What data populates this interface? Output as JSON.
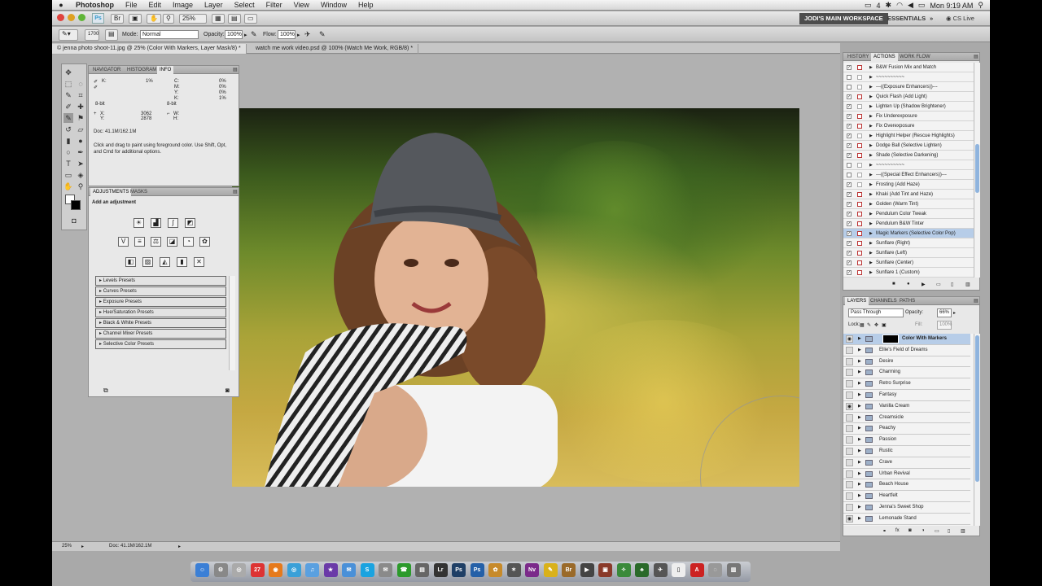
{
  "menubar": {
    "app_name": "Photoshop",
    "items": [
      "File",
      "Edit",
      "Image",
      "Layer",
      "Select",
      "Filter",
      "View",
      "Window",
      "Help"
    ],
    "status": {
      "battery": "4",
      "clock": "Mon 9:19 AM"
    }
  },
  "appbar": {
    "zoom": "25%",
    "workspace_primary": "JODI'S MAIN WORKSPACE",
    "workspace_secondary": "ESSENTIALS",
    "more": "»",
    "cs_live": "CS Live"
  },
  "options": {
    "brush_size": "1700",
    "mode_label": "Mode:",
    "mode_value": "Normal",
    "opacity_label": "Opacity:",
    "opacity_value": "100%",
    "flow_label": "Flow:",
    "flow_value": "100%"
  },
  "tabs": [
    {
      "label": "© jenna photo shoot-11.jpg @ 25% (Color With Markers, Layer Mask/8) *",
      "active": true
    },
    {
      "label": "watch me work video.psd @ 100% (Watch Me Work, RGB/8) *",
      "active": false
    }
  ],
  "info_panel": {
    "tabs": [
      "NAVIGATOR",
      "HISTOGRAM",
      "INFO"
    ],
    "r_label": "K:",
    "r_value": "1%",
    "c_label": "C:",
    "c_value": "0%",
    "m_label": "M:",
    "m_value": "0%",
    "y_label": "Y:",
    "y_value": "0%",
    "k_label": "K:",
    "k_value": "1%",
    "bit_left": "8-bit",
    "bit_right": "8-bit",
    "x_label": "X:",
    "x_value": "3062",
    "y_coord_label": "Y:",
    "y_coord_value": "2878",
    "w_label": "W:",
    "h_label": "H:",
    "doc": "Doc: 41.1M/162.1M",
    "hint": "Click and drag to paint using foreground color.  Use Shift, Opt, and Cmd for additional options."
  },
  "adjustments_panel": {
    "tabs": [
      "ADJUSTMENTS",
      "MASKS"
    ],
    "heading": "Add an adjustment",
    "presets": [
      "Levels Presets",
      "Curves Presets",
      "Exposure Presets",
      "Hue/Saturation Presets",
      "Black & White Presets",
      "Channel Mixer Presets",
      "Selective Color Presets"
    ]
  },
  "actions_panel": {
    "tabs": [
      "HISTORY",
      "ACTIONS",
      "WORK FLOW"
    ],
    "rows": [
      {
        "label": "B&W Fusion Mix and Match",
        "checked": true,
        "dialog": true
      },
      {
        "label": "~~~~~~~~~~",
        "checked": false,
        "dialog": false
      },
      {
        "label": "---((Exposure Enhancers))---",
        "checked": false,
        "dialog": false
      },
      {
        "label": "Quick Flash (Add Light)",
        "checked": true,
        "dialog": true
      },
      {
        "label": "Lighten Up (Shadow Brightener)",
        "checked": true,
        "dialog": false
      },
      {
        "label": "Fix Underexposure",
        "checked": true,
        "dialog": true
      },
      {
        "label": "Fix Overexposure",
        "checked": true,
        "dialog": true
      },
      {
        "label": "Highlight Helper (Rescue Highlights)",
        "checked": true,
        "dialog": false
      },
      {
        "label": "Dodge Ball (Selective Lighten)",
        "checked": true,
        "dialog": true
      },
      {
        "label": "Shade (Selective Darkening)",
        "checked": true,
        "dialog": true
      },
      {
        "label": "~~~~~~~~~~",
        "checked": false,
        "dialog": false
      },
      {
        "label": "---((Special Effect Enhancers))---",
        "checked": false,
        "dialog": false
      },
      {
        "label": "Frosting (Add Haze)",
        "checked": true,
        "dialog": false
      },
      {
        "label": "Khaki (Add Tint and Haze)",
        "checked": true,
        "dialog": true
      },
      {
        "label": "Golden (Warm Tint)",
        "checked": true,
        "dialog": true
      },
      {
        "label": "Pendulum Color Tweak",
        "checked": true,
        "dialog": true
      },
      {
        "label": "Pendulum B&W Tinter",
        "checked": true,
        "dialog": true
      },
      {
        "label": "Magic Markers (Selective Color Pop)",
        "checked": true,
        "dialog": true,
        "selected": true
      },
      {
        "label": "Sunflare (Right)",
        "checked": true,
        "dialog": true
      },
      {
        "label": "Sunflare (Left)",
        "checked": true,
        "dialog": true
      },
      {
        "label": "Sunflare (Center)",
        "checked": true,
        "dialog": true
      },
      {
        "label": "Sunflare 1 (Custom)",
        "checked": true,
        "dialog": true
      }
    ]
  },
  "layers_panel": {
    "tabs": [
      "LAYERS",
      "CHANNELS",
      "PATHS"
    ],
    "blend_mode": "Pass Through",
    "opacity_label": "Opacity:",
    "opacity_value": "66%",
    "lock_label": "Lock:",
    "fill_label": "Fill:",
    "fill_value": "100%",
    "layers": [
      {
        "name": "Color With Markers",
        "visible": true,
        "selected": true
      },
      {
        "name": "Ellie's Field of Dreams",
        "visible": false
      },
      {
        "name": "Desire",
        "visible": false
      },
      {
        "name": "Charming",
        "visible": false
      },
      {
        "name": "Retro Surprise",
        "visible": false
      },
      {
        "name": "Fantasy",
        "visible": false
      },
      {
        "name": "Vanilla Cream",
        "visible": true
      },
      {
        "name": "Creamsicle",
        "visible": false
      },
      {
        "name": "Peachy",
        "visible": false
      },
      {
        "name": "Passion",
        "visible": false
      },
      {
        "name": "Rustic",
        "visible": false
      },
      {
        "name": "Crave",
        "visible": false
      },
      {
        "name": "Urban Revival",
        "visible": false
      },
      {
        "name": "Beach House",
        "visible": false
      },
      {
        "name": "Heartfelt",
        "visible": false
      },
      {
        "name": "Jenna's Sweet Shop",
        "visible": false
      },
      {
        "name": "Lemonade Stand",
        "visible": true
      }
    ]
  },
  "statusbar": {
    "zoom": "25%",
    "doc": "Doc: 41.1M/162.1M"
  },
  "dock": {
    "icons": [
      {
        "name": "finder-icon",
        "color": "#3b7fd6",
        "glyph": "☺"
      },
      {
        "name": "system-preferences-icon",
        "color": "#888",
        "glyph": "⚙"
      },
      {
        "name": "compass-icon",
        "color": "#aaa",
        "glyph": "◎"
      },
      {
        "name": "calendar-icon",
        "color": "#d33",
        "glyph": "27"
      },
      {
        "name": "firefox-icon",
        "color": "#e67a1c",
        "glyph": "◉"
      },
      {
        "name": "safari-icon",
        "color": "#3aa0d8",
        "glyph": "◎"
      },
      {
        "name": "itunes-icon",
        "color": "#5aa0e0",
        "glyph": "♫"
      },
      {
        "name": "imovie-icon",
        "color": "#6a3aa8",
        "glyph": "★"
      },
      {
        "name": "ichat-icon",
        "color": "#4a90d8",
        "glyph": "✉"
      },
      {
        "name": "skype-icon",
        "color": "#1aa3e0",
        "glyph": "S"
      },
      {
        "name": "mail-icon",
        "color": "#8a8a8a",
        "glyph": "✉"
      },
      {
        "name": "facetime-icon",
        "color": "#2c9a2c",
        "glyph": "☎"
      },
      {
        "name": "finder-window-icon",
        "color": "#666",
        "glyph": "▤"
      },
      {
        "name": "lightroom-icon",
        "color": "#333",
        "glyph": "Lr"
      },
      {
        "name": "photoshop-cs4-icon",
        "color": "#1f3f66",
        "glyph": "Ps"
      },
      {
        "name": "photoshop-cs5-icon",
        "color": "#2460a8",
        "glyph": "Ps"
      },
      {
        "name": "flower-icon",
        "color": "#c78a2a",
        "glyph": "✿"
      },
      {
        "name": "network-icon",
        "color": "#555",
        "glyph": "✶"
      },
      {
        "name": "nvu-icon",
        "color": "#7b2a8a",
        "glyph": "Nv"
      },
      {
        "name": "pencil-icon",
        "color": "#d9b11a",
        "glyph": "✎"
      },
      {
        "name": "bridge-icon",
        "color": "#9a6a2a",
        "glyph": "Br"
      },
      {
        "name": "video-icon",
        "color": "#444",
        "glyph": "▶"
      },
      {
        "name": "movie-icon",
        "color": "#8a3a2a",
        "glyph": "▣"
      },
      {
        "name": "plant-icon",
        "color": "#3a8a3a",
        "glyph": "✧"
      },
      {
        "name": "tree-icon",
        "color": "#2a6a2a",
        "glyph": "♣"
      },
      {
        "name": "airplane-icon",
        "color": "#555",
        "glyph": "✈"
      },
      {
        "name": "document-icon",
        "color": "#eee",
        "glyph": "▯"
      },
      {
        "name": "acrobat-icon",
        "color": "#c22",
        "glyph": "A"
      },
      {
        "name": "disk-icon",
        "color": "#999",
        "glyph": "◌"
      },
      {
        "name": "trash-icon",
        "color": "#777",
        "glyph": "▥"
      }
    ]
  }
}
